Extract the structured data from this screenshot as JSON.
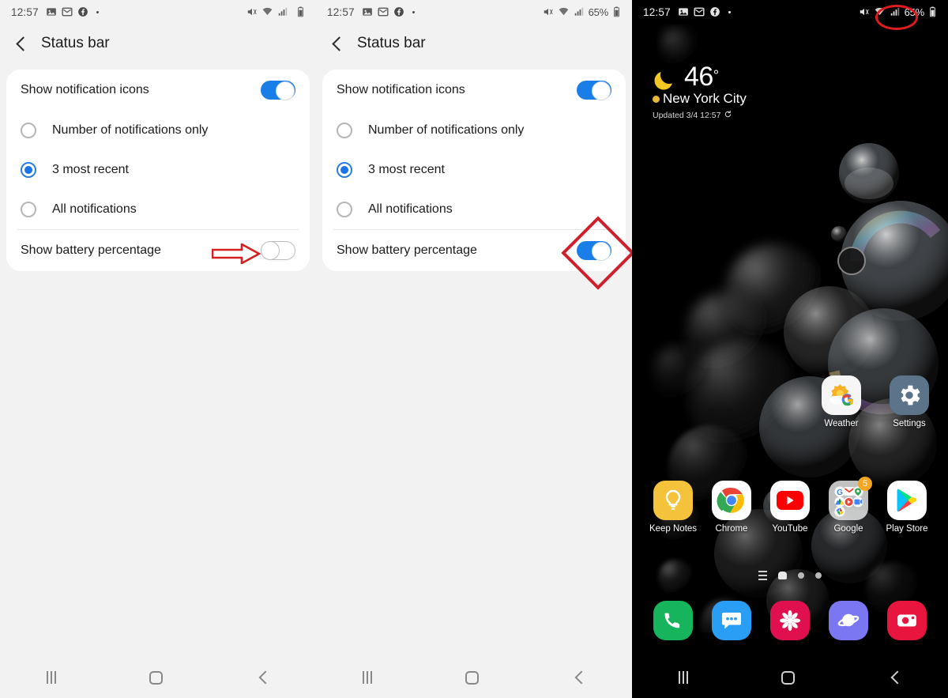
{
  "panels": [
    {
      "id": "settings-off",
      "statusbar": {
        "time": "12:57",
        "icons": [
          "image-icon",
          "gmail-icon",
          "facebook-icon",
          "dot-icon"
        ],
        "right_icons": [
          "mute-icon",
          "wifi-icon",
          "signal-icon",
          "battery-icon"
        ],
        "battery_percent": "",
        "theme": "light"
      },
      "header": {
        "title": "Status bar",
        "back_label": "Back"
      },
      "card": {
        "toggle_row": {
          "label": "Show notification icons",
          "state": "on"
        },
        "radios": [
          {
            "label": "Number of notifications only",
            "selected": false
          },
          {
            "label": "3 most recent",
            "selected": true
          },
          {
            "label": "All notifications",
            "selected": false
          }
        ],
        "battery_row": {
          "label": "Show battery percentage",
          "state": "off"
        }
      },
      "annotation": {
        "type": "arrow",
        "color": "#d42020",
        "points_to": "battery-percentage-toggle"
      },
      "navbar": {
        "recents": "Recents",
        "home": "Home",
        "back": "Back"
      }
    },
    {
      "id": "settings-on",
      "statusbar": {
        "time": "12:57",
        "icons": [
          "image-icon",
          "gmail-icon",
          "facebook-icon",
          "dot-icon"
        ],
        "right_icons": [
          "mute-icon",
          "wifi-icon",
          "signal-icon",
          "battery-icon"
        ],
        "battery_percent": "65%",
        "theme": "light"
      },
      "header": {
        "title": "Status bar",
        "back_label": "Back"
      },
      "card": {
        "toggle_row": {
          "label": "Show notification icons",
          "state": "on"
        },
        "radios": [
          {
            "label": "Number of notifications only",
            "selected": false
          },
          {
            "label": "3 most recent",
            "selected": true
          },
          {
            "label": "All notifications",
            "selected": false
          }
        ],
        "battery_row": {
          "label": "Show battery percentage",
          "state": "on"
        }
      },
      "annotation": {
        "type": "diamond",
        "color": "#cf1f2a",
        "points_to": "battery-percentage-toggle"
      },
      "navbar": {
        "recents": "Recents",
        "home": "Home",
        "back": "Back"
      }
    }
  ],
  "home": {
    "statusbar": {
      "time": "12:57",
      "icons": [
        "image-icon",
        "gmail-icon",
        "facebook-icon",
        "dot-icon"
      ],
      "right_icons": [
        "mute-icon",
        "wifi-icon",
        "signal-icon",
        "battery-icon"
      ],
      "battery_percent": "65%",
      "theme": "dark",
      "highlight": {
        "type": "circle",
        "color": "#e01b1b",
        "target": "battery-percent-text"
      }
    },
    "weather_widget": {
      "condition_icon": "moon-icon",
      "temperature": "46",
      "degree": "°",
      "city": "New York City",
      "updated": "Updated 3/4 12:57",
      "refresh_icon": "refresh-icon"
    },
    "apps_top": [
      {
        "label": "Weather",
        "icon": "google-weather-icon"
      },
      {
        "label": "Settings",
        "icon": "gear-icon"
      }
    ],
    "apps_main": [
      {
        "label": "Keep Notes",
        "icon": "keep-notes-icon"
      },
      {
        "label": "Chrome",
        "icon": "chrome-icon"
      },
      {
        "label": "YouTube",
        "icon": "youtube-icon"
      },
      {
        "label": "Google",
        "icon": "google-folder-icon",
        "badge": "5"
      },
      {
        "label": "Play Store",
        "icon": "play-store-icon"
      }
    ],
    "page_indicator": {
      "items": [
        "app-list-icon",
        "home-page-dot",
        "page-dot",
        "page-dot"
      ],
      "active_index": 1
    },
    "dock": [
      {
        "label": "Phone",
        "icon": "phone-icon"
      },
      {
        "label": "Messages",
        "icon": "messages-icon"
      },
      {
        "label": "Gallery",
        "icon": "gallery-icon"
      },
      {
        "label": "Internet",
        "icon": "internet-icon"
      },
      {
        "label": "Camera",
        "icon": "camera-icon"
      }
    ],
    "navbar": {
      "recents": "Recents",
      "home": "Home",
      "back": "Back"
    }
  },
  "colors": {
    "accent_blue": "#1a7ee8",
    "annotation_red": "#d42020",
    "bg_gray": "#f2f2f2",
    "card_white": "#ffffff"
  }
}
